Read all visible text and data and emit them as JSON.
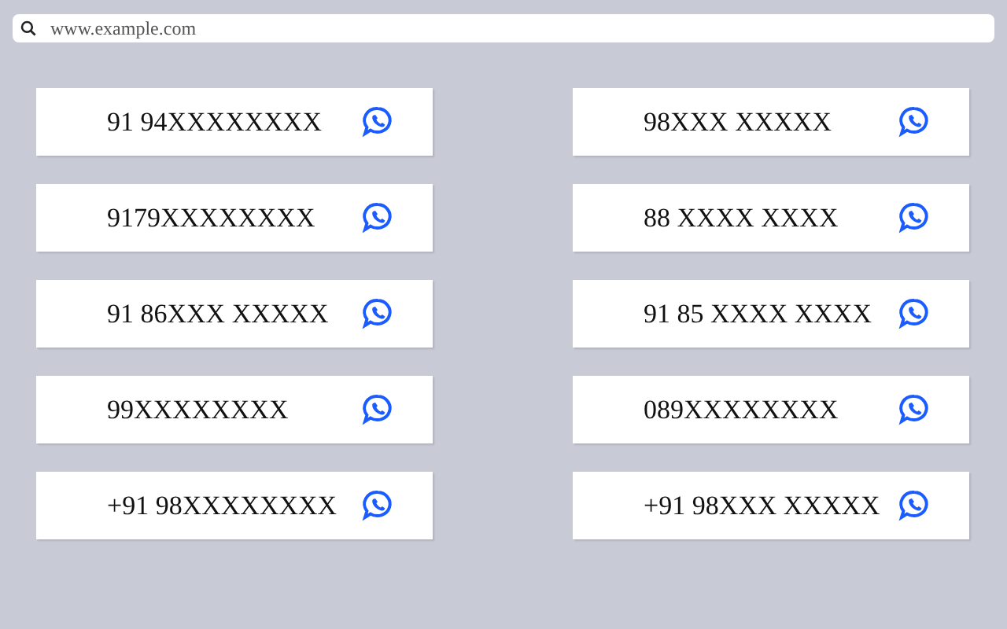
{
  "address_bar": {
    "value": "www.example.com"
  },
  "columns": [
    {
      "cards": [
        {
          "number": "91 94XXXXXXXX"
        },
        {
          "number": "9179XXXXXXXX"
        },
        {
          "number": "91 86XXX XXXXX"
        },
        {
          "number": "99XXXXXXXX"
        },
        {
          "number": "+91 98XXXXXXXX"
        }
      ]
    },
    {
      "cards": [
        {
          "number": "98XXX XXXXX"
        },
        {
          "number": "88 XXXX XXXX"
        },
        {
          "number": "91 85 XXXX XXXX"
        },
        {
          "number": "089XXXXXXXX"
        },
        {
          "number": "+91 98XXX XXXXX"
        }
      ]
    }
  ]
}
